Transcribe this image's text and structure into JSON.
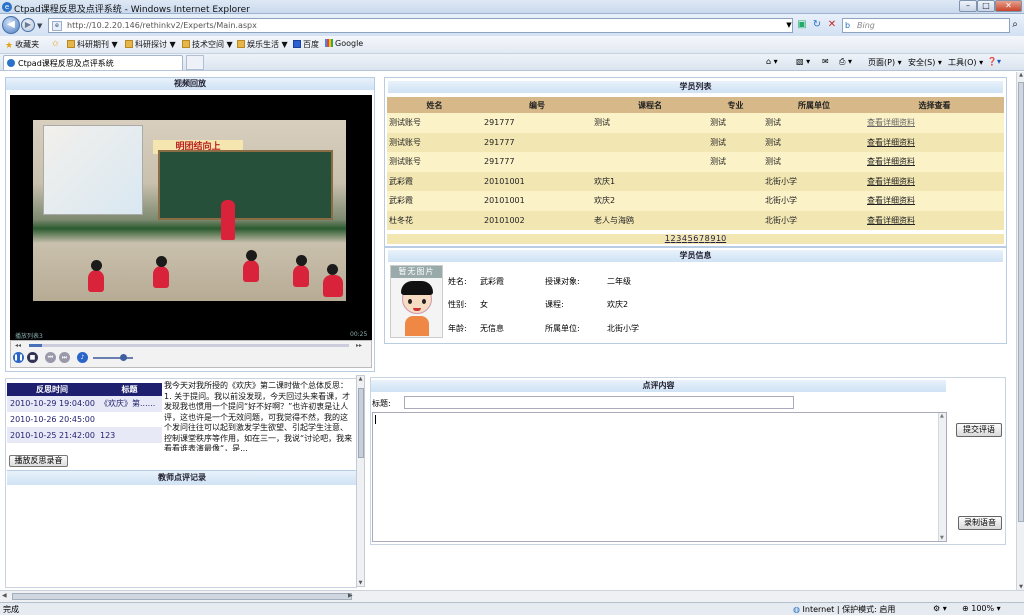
{
  "window": {
    "title": "Ctpad课程反思及点评系统 - Windows Internet Explorer"
  },
  "browser": {
    "url": "http://10.2.20.146/rethinkv2/Experts/Main.aspx",
    "search_placeholder": "Bing",
    "favorites_label": "收藏夹",
    "favorites": [
      "科研期刊",
      "科研探讨",
      "技术空间",
      "娱乐生活",
      "百度",
      "Google"
    ],
    "tab_title": "Ctpad课程反思及点评系统",
    "commands": [
      "页面(P)",
      "安全(S)",
      "工具(O)"
    ],
    "status_left": "完成",
    "status_zone": "Internet | 保护模式: 启用",
    "zoom": "100%"
  },
  "video": {
    "title": "视频回放",
    "status_left": "播放列表3",
    "time": "00:25",
    "banner": "明团结向上",
    "playback_progress": 0.04,
    "volume_level": 0.75
  },
  "reflections": {
    "col_time": "反思时间",
    "col_title": "标题",
    "rows": [
      {
        "time": "2010-10-29 19:04:00",
        "title": "《欢庆》第......"
      },
      {
        "time": "2010-10-26 20:45:00",
        "title": ""
      },
      {
        "time": "2010-10-25 21:42:00",
        "title": "123"
      }
    ],
    "play_button": "播放反思录音",
    "text": "我今天对我所授的《欢庆》第二课时做个总体反思：\n1. 关于提问。我以前没发现，今天回过头来看课，才发现我也惯用一个提问“好不好啊？”也许初衷是让人评，这也许是一个无效问题，可我觉得不然，我的这个发问往往可以起到激发学生欲望、引起学生注意、控制课堂秩序等作用，如在三一，我说“讨论吧，我来看看谁表演最像“，是..."
  },
  "teacher_comments": {
    "title": "教师点评记录"
  },
  "students": {
    "title": "学员列表",
    "headers": [
      "姓名",
      "编号",
      "课程名",
      "专业",
      "所属单位",
      "选择查看"
    ],
    "rows": [
      {
        "name": "测试账号",
        "id": "291777",
        "course": "测试",
        "major": "测试",
        "unit": "测试",
        "action": "查看详细资料"
      },
      {
        "name": "测试账号",
        "id": "291777",
        "course": "",
        "major": "测试",
        "unit": "测试",
        "action": "查看详细资料"
      },
      {
        "name": "测试账号",
        "id": "291777",
        "course": "",
        "major": "测试",
        "unit": "测试",
        "action": "查看详细资料"
      },
      {
        "name": "武彩霞",
        "id": "20101001",
        "course": "欢庆1",
        "major": "",
        "unit": "北街小学",
        "action": "查看详细资料"
      },
      {
        "name": "武彩霞",
        "id": "20101001",
        "course": "欢庆2",
        "major": "",
        "unit": "北街小学",
        "action": "查看详细资料"
      },
      {
        "name": "杜冬花",
        "id": "20101002",
        "course": "老人与海鸥",
        "major": "",
        "unit": "北街小学",
        "action": "查看详细资料"
      }
    ],
    "pages": [
      "1",
      "2",
      "3",
      "4",
      "5",
      "6",
      "7",
      "8",
      "9",
      "10"
    ]
  },
  "student_info": {
    "title": "学员信息",
    "avatar_text": "暂无图片",
    "name_label": "姓名:",
    "name": "武彩霞",
    "target_label": "授课对象:",
    "target": "二年级",
    "gender_label": "性别:",
    "gender": "女",
    "course_label": "课程:",
    "course": "欢庆2",
    "age_label": "年龄:",
    "age": "无信息",
    "unit_label": "所属单位:",
    "unit": "北街小学"
  },
  "comment": {
    "title": "点评内容",
    "title_label": "标题:",
    "submit_button": "提交评语",
    "record_button": "录制语音"
  },
  "colors": {
    "accent": "#1e1f6e",
    "table_header": "#d7b889",
    "row_light": "#fbf2c8",
    "row_dark": "#f2e6b3",
    "panel_head": "#cfe2f4"
  }
}
